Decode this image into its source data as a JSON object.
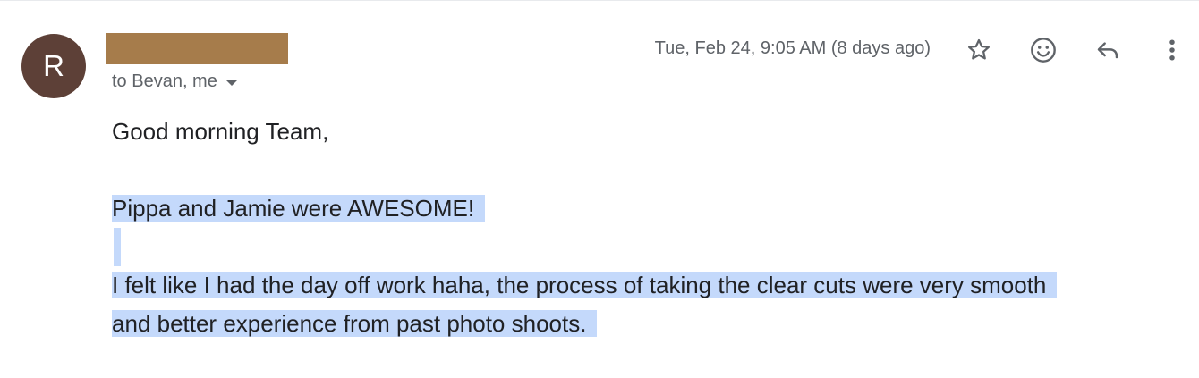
{
  "avatar": {
    "initial": "R",
    "color": "#5d4037"
  },
  "sender": {
    "redaction_color": "#a67c4b"
  },
  "recipients": {
    "label": "to Bevan, me"
  },
  "timestamp": "Tue, Feb 24, 9:05 AM (8 days ago)",
  "toolbar": {
    "star_icon": "star-icon",
    "emoji_icon": "emoji-icon",
    "reply_icon": "reply-icon",
    "more_icon": "more-vert-icon"
  },
  "body": {
    "greeting": "Good morning Team,",
    "line1": "Pippa and Jamie were AWESOME!",
    "line2a": "I felt like I had the day off work haha, the process of taking the clear cuts were very smooth",
    "line2b": "and better experience from past photo shoots."
  },
  "highlight_color": "#c4d9fb"
}
